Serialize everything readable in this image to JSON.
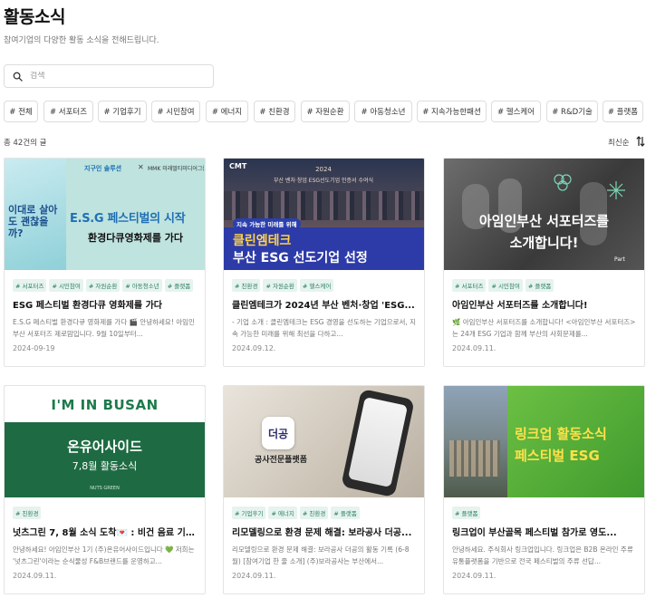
{
  "header": {
    "title": "활동소식",
    "subtitle": "참여기업의 다양한 활동 소식을 전해드립니다."
  },
  "search": {
    "placeholder": "검색",
    "value": ""
  },
  "categories": [
    {
      "label": "# 전체"
    },
    {
      "label": "# 서포터즈"
    },
    {
      "label": "# 기업후기"
    },
    {
      "label": "# 시민참여"
    },
    {
      "label": "# 에너지"
    },
    {
      "label": "# 친환경"
    },
    {
      "label": "# 자원순환"
    },
    {
      "label": "# 아동청소년"
    },
    {
      "label": "# 지속가능한패션"
    },
    {
      "label": "# 헬스케어"
    },
    {
      "label": "# R&D기술"
    },
    {
      "label": "# 플랫폼"
    }
  ],
  "list": {
    "count": "총 42건의 글",
    "sort": "최신순"
  },
  "cards": [
    {
      "tags": [
        "# 서포터즈",
        "# 시민참여",
        "# 자원순환",
        "# 아동청소년",
        "# 플랫폼"
      ],
      "title": "ESG 페스티벌 환경다큐 영화제를 가다",
      "desc": "E.S.G 페스티벌 환경다큐 영화제를 가다 🎬 안녕하세요! 아임인부산 서포터즈 제로맘입니다. 9월 10일부터...",
      "date": "2024-09-19",
      "image": {
        "brand_left": "지구인 솔루션",
        "brand_sep": "✕",
        "brand_right": "MMK 미래멀티미디어그룹",
        "badge": "E.S.G 페스티벌의 시작",
        "headline": "환경다큐영화제를 가다",
        "poster_text": "이대로 살아도 괜찮을까?"
      }
    },
    {
      "tags": [
        "# 친환경",
        "# 자원순환",
        "# 헬스케어"
      ],
      "title": "클린엠테크가 2024년 부산 벤처·창업 'ESG...",
      "desc": "- 기업 소개 : 클린엠테크는 ESG 경영을 선도하는 기업으로서, 지속 가능한 미래를 위해 최선을 다하고...",
      "date": "2024.09.12.",
      "image": {
        "logo": "CMT",
        "banner_year": "2024",
        "banner_line": "부산 벤처·창업 ESG선도기업 인증서 수여식",
        "caption": "지속 가능한 미래를 위해",
        "headline1": "클린엠테크",
        "headline2": "부산 ESG 선도기업 선정"
      }
    },
    {
      "tags": [
        "# 서포터즈",
        "# 시민참여",
        "# 플랫폼"
      ],
      "title": "아임인부산 서포터즈를 소개합니다!",
      "desc": "🌿 아임인부산 서포터즈를 소개합니다! <아임인부산 서포터즈>는 24개 ESG 기업과 함께 부산의 사회문제를...",
      "date": "2024.09.11.",
      "image": {
        "headline1": "아임인부산 서포터즈를",
        "headline2": "소개합니다!",
        "mark": "Part"
      }
    },
    {
      "tags": [
        "# 친환경"
      ],
      "title": "넛츠그린 7, 8월 소식 도착💌 : 비건 음료 기부...",
      "desc": "안녕하세요! 아임인부산 1기 (주)온유어사이드입니다 💚 저희는 '넛츠그린'이라는 순식물성 F&B브랜드를 운영하고...",
      "date": "2024.09.11.",
      "image": {
        "logo": "I'M IN BUSAN",
        "headline": "온유어사이드",
        "sub": "7,8월 활동소식",
        "foot": "NUTS GREEN"
      }
    },
    {
      "tags": [
        "# 기업후기",
        "# 에너지",
        "# 친환경",
        "# 플랫폼"
      ],
      "title": "리모델링으로 환경 문제 해결: 보라공사 더공...",
      "desc": "리모델링으로 환경 문제 해결: 보라공사 더공의 활동 기록 (6-8월) [참여기업 한 줄 소개] (주)보라공사는 부산에서...",
      "date": "2024.09.11.",
      "image": {
        "app_name": "더공",
        "caption": "공사전문플랫폼"
      }
    },
    {
      "tags": [
        "# 플랫폼"
      ],
      "title": "링크업이 부산골목 페스티벌 참가로 영도...",
      "desc": "안녕하세요. 주식회사 링크업입니다. 링크업은 B2B 온라인 주류유통플랫폼을 기반으로 전국 페스티벌의 주류 선답...",
      "date": "2024.09.11.",
      "image": {
        "headline1": "링크업 활동소식",
        "headline2": "페스티벌 ESG"
      }
    }
  ]
}
